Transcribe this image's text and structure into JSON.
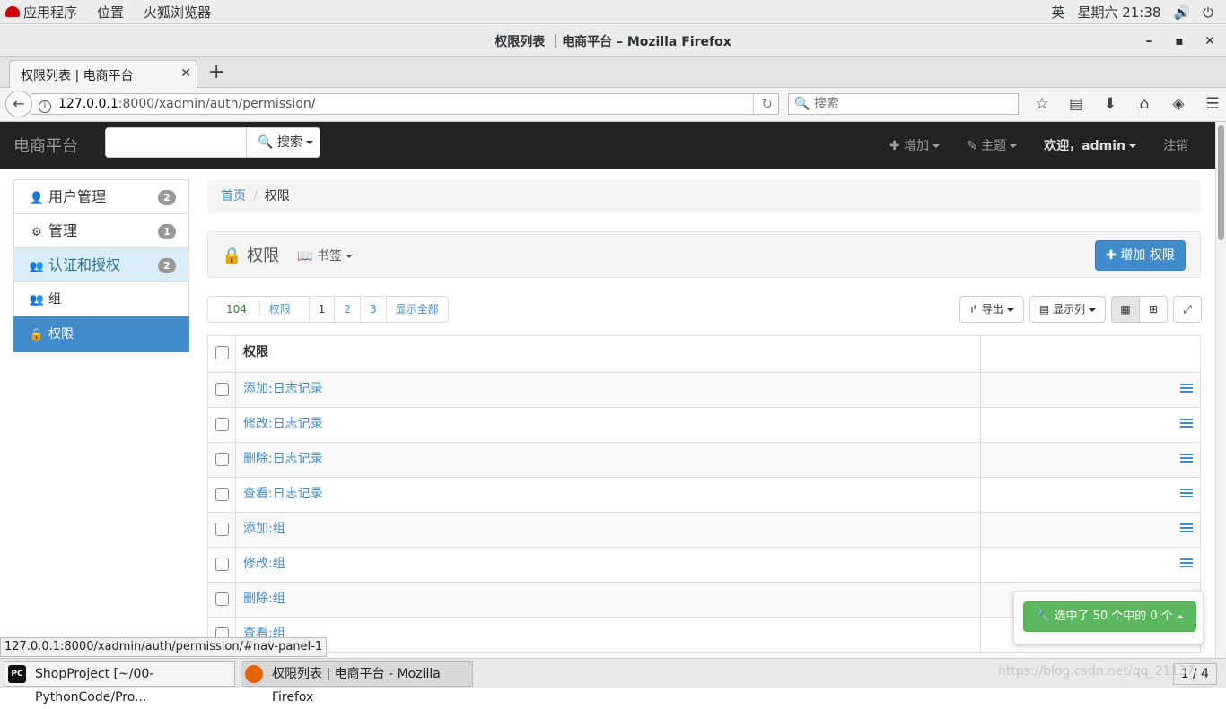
{
  "gnome": {
    "apps": "应用程序",
    "places": "位置",
    "browser": "火狐浏览器",
    "lang": "英",
    "clock": "星期六 21:38"
  },
  "window": {
    "title": "权限列表 ｜电商平台  –  Mozilla Firefox"
  },
  "tab": {
    "label": "权限列表 | 电商平台"
  },
  "urlbar": {
    "host": "127.0.0.1",
    "path": ":8000/xadmin/auth/permission/"
  },
  "searchbar": {
    "placeholder": "搜索"
  },
  "site": {
    "brand": "电商平台",
    "search_btn": "搜索",
    "add_menu": "增加",
    "theme_menu": "主题",
    "welcome": "欢迎，admin",
    "logout": "注销"
  },
  "sidebar": {
    "items": [
      {
        "label": "用户管理",
        "badge": "2"
      },
      {
        "label": "管理",
        "badge": "1"
      },
      {
        "label": "认证和授权",
        "badge": "2"
      },
      {
        "label": "组"
      },
      {
        "label": "权限"
      }
    ]
  },
  "breadcrumb": {
    "home": "首页",
    "current": "权限"
  },
  "title_panel": {
    "title": "权限",
    "bookmark": "书签",
    "add_button": "增加 权限"
  },
  "pager": {
    "count": "104",
    "unit": "权限",
    "pages": [
      "1",
      "2",
      "3"
    ],
    "show_all": "显示全部"
  },
  "toolbar": {
    "export": "导出",
    "columns": "显示列"
  },
  "table": {
    "header": "权限",
    "rows": [
      "添加:日志记录",
      "修改:日志记录",
      "删除:日志记录",
      "查看:日志记录",
      "添加:组",
      "修改:组",
      "删除:组",
      "查看:组"
    ]
  },
  "action": {
    "label": "选中了 50 个中的 0 个"
  },
  "status_url": "127.0.0.1:8000/xadmin/auth/permission/#nav-panel-1",
  "taskbar": {
    "task1": "ShopProject [~/00-PythonCode/Pro...",
    "task2": "权限列表 | 电商平台 - Mozilla Firefox",
    "pages": "1 / 4"
  },
  "watermark": "https://blog.csdn.net/qq_21137..."
}
